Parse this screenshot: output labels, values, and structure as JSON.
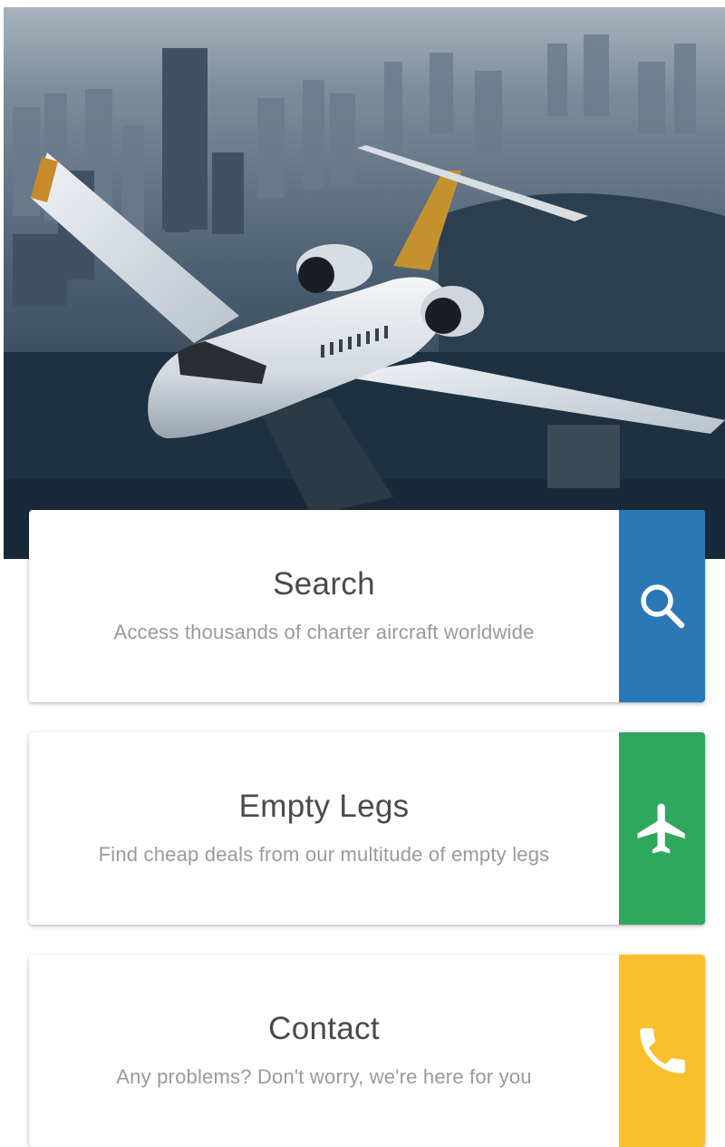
{
  "hero": {
    "image": "private-jet-flying-over-city"
  },
  "cards": [
    {
      "title": "Search",
      "subtitle": "Access thousands of charter aircraft worldwide",
      "icon": "search-icon",
      "color": "#2b78b6"
    },
    {
      "title": "Empty Legs",
      "subtitle": "Find cheap deals from our multitude of empty legs",
      "icon": "airplane-icon",
      "color": "#2fa75c"
    },
    {
      "title": "Contact",
      "subtitle": "Any problems? Don't worry, we're here for you",
      "icon": "phone-icon",
      "color": "#f9c02b"
    }
  ]
}
